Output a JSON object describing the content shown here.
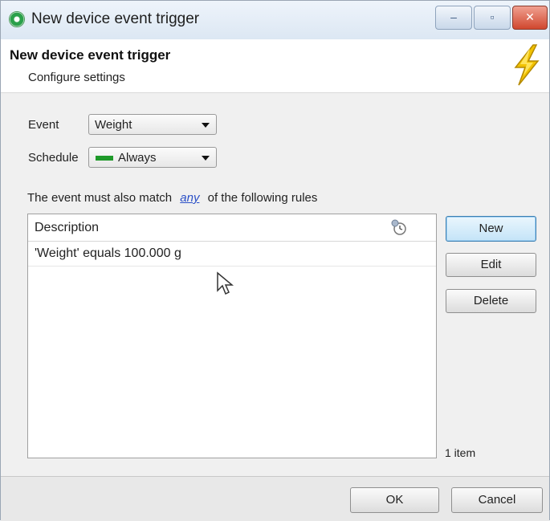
{
  "window": {
    "title": "New device event trigger",
    "controls": {
      "minimize": "–",
      "maximize": "▫",
      "close": "✕"
    }
  },
  "header": {
    "title": "New device event trigger",
    "subtitle": "Configure settings",
    "icon": "lightning-bolt-icon"
  },
  "form": {
    "event_label": "Event",
    "event_value": "Weight",
    "schedule_label": "Schedule",
    "schedule_value": "Always",
    "schedule_color": "#1f9a2a"
  },
  "rules": {
    "prefix": "The event must also match",
    "match_mode": "any",
    "suffix": "of the following rules",
    "column_header": "Description",
    "column_icon": "column-chooser-icon",
    "items": [
      {
        "description": "'Weight' equals 100.000 g"
      }
    ],
    "count_text": "1 item"
  },
  "buttons": {
    "new": "New",
    "edit": "Edit",
    "delete": "Delete",
    "ok": "OK",
    "cancel": "Cancel"
  },
  "colors": {
    "link": "#2a4fc7",
    "bolt": "#f2c200"
  }
}
